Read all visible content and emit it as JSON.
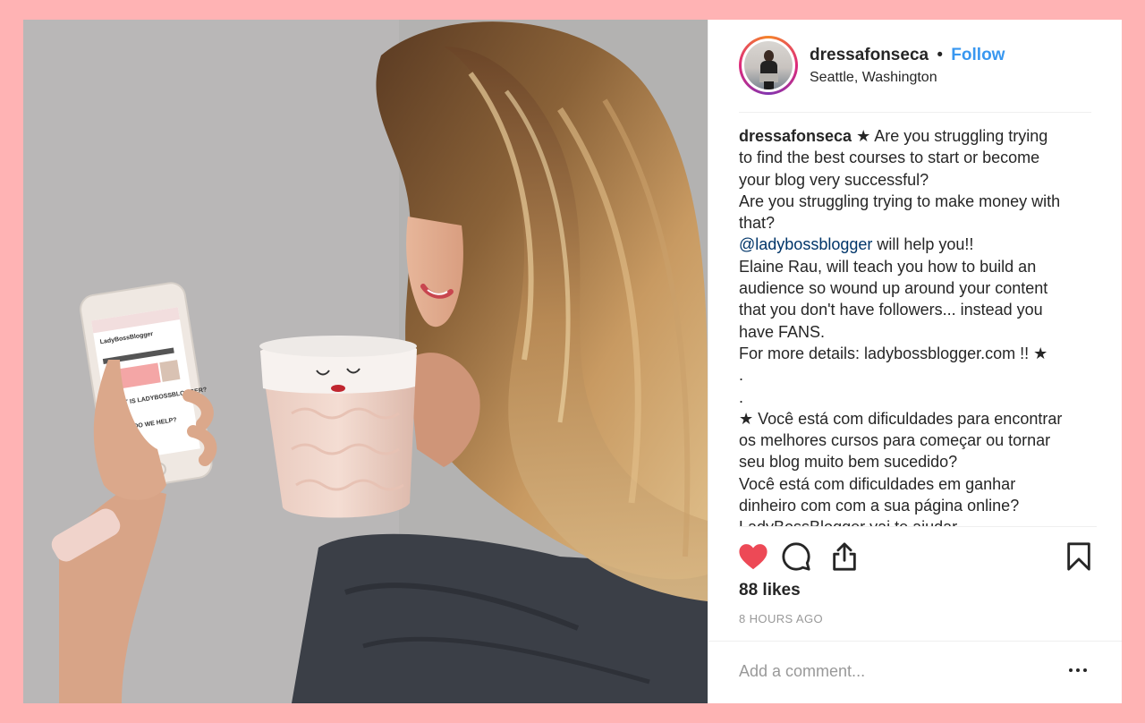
{
  "post": {
    "username": "dressafonseca",
    "separator": "•",
    "follow_label": "Follow",
    "location": "Seattle, Washington"
  },
  "photo": {
    "phone_screen_title": "LadyBossBlogger",
    "phone_screen_heading": "WHAT IS LADYBOSSBLOGGER?",
    "phone_screen_subheading": "WHAT DO WE HELP?"
  },
  "caption": {
    "author": "dressafonseca",
    "lines": [
      " ★ Are you struggling trying",
      "to find the best courses to start or become",
      "your blog very successful?",
      "Are you struggling trying to make money with",
      "that?"
    ],
    "mention": "@ladybossblogger",
    "mention_suffix": " will help you!!",
    "lines_after": [
      "Elaine Rau, will teach you how to build an",
      "audience so wound up around your content",
      "that you don't have followers... instead you",
      "have FANS.",
      "For more details: ladybossblogger.com !! ★",
      ".",
      ".",
      "★ Você está com dificuldades para encontrar",
      "os melhores cursos para começar ou tornar",
      "seu blog muito bem sucedido?",
      "Você está com dificuldades em ganhar",
      "dinheiro com com a sua página online?",
      "LadyBossBlogger vai te ajudar"
    ]
  },
  "actions": {
    "like_icon": "heart-icon",
    "comment_icon": "comment-bubble-icon",
    "share_icon": "share-upload-icon",
    "save_icon": "bookmark-icon",
    "liked": true,
    "like_color": "#ed4956"
  },
  "likes_label": "88 likes",
  "timestamp": "8 HOURS AGO",
  "comment": {
    "placeholder": "Add a comment...",
    "more_icon": "more-options-icon"
  },
  "colors": {
    "page_background": "#ffb3b4",
    "link": "#3897f0",
    "mention": "#003569",
    "muted": "#999999"
  }
}
